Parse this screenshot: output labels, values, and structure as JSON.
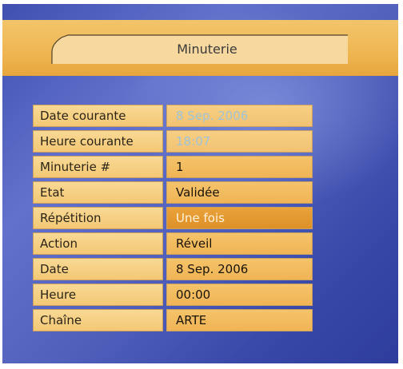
{
  "header": {
    "title": "Minuterie"
  },
  "form": {
    "rows": [
      {
        "label": "Date courante",
        "value": "8  Sep.  2006",
        "state": "dim"
      },
      {
        "label": "Heure courante",
        "value": "18:07",
        "state": "dim"
      },
      {
        "label": "Minuterie #",
        "value": "1",
        "state": "normal"
      },
      {
        "label": "Etat",
        "value": "Validée",
        "state": "normal"
      },
      {
        "label": "Répétition",
        "value": "Une fois",
        "state": "selected"
      },
      {
        "label": "Action",
        "value": "Réveil",
        "state": "normal"
      },
      {
        "label": "Date",
        "value": "8  Sep.  2006",
        "state": "normal"
      },
      {
        "label": "Heure",
        "value": "00:00",
        "state": "normal"
      },
      {
        "label": "Chaîne",
        "value": "ARTE",
        "state": "normal"
      }
    ]
  },
  "colors": {
    "background": "#4a5ab8",
    "header_band": "#efb652",
    "field": "#f0b455",
    "field_selected": "#e29a30",
    "dim_text": "#9fc4d8"
  }
}
